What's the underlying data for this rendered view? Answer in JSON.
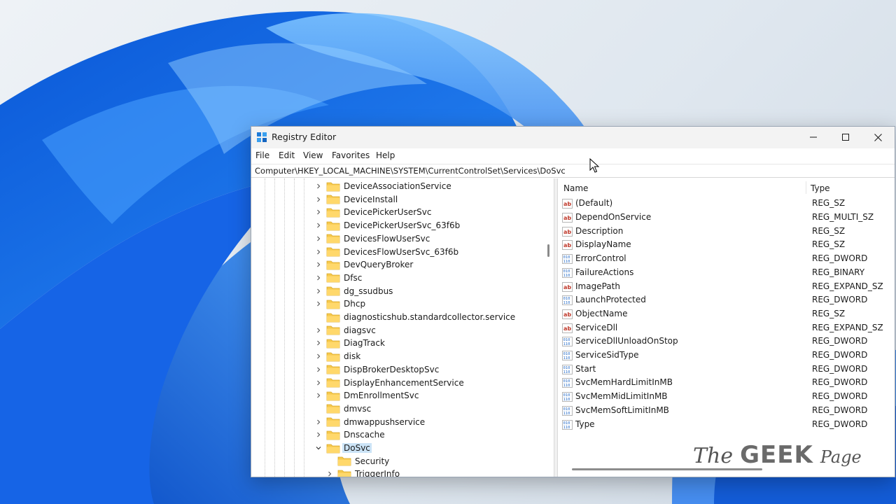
{
  "window": {
    "title": "Registry Editor",
    "icon": "registry-editor-icon"
  },
  "menu": [
    "File",
    "Edit",
    "View",
    "Favorites",
    "Help"
  ],
  "address": "Computer\\HKEY_LOCAL_MACHINE\\SYSTEM\\CurrentControlSet\\Services\\DoSvc",
  "tree": {
    "items": [
      {
        "label": "DeviceAssociationService",
        "expander": "collapsed"
      },
      {
        "label": "DeviceInstall",
        "expander": "collapsed"
      },
      {
        "label": "DevicePickerUserSvc",
        "expander": "collapsed"
      },
      {
        "label": "DevicePickerUserSvc_63f6b",
        "expander": "collapsed"
      },
      {
        "label": "DevicesFlowUserSvc",
        "expander": "collapsed"
      },
      {
        "label": "DevicesFlowUserSvc_63f6b",
        "expander": "collapsed"
      },
      {
        "label": "DevQueryBroker",
        "expander": "collapsed"
      },
      {
        "label": "Dfsc",
        "expander": "collapsed"
      },
      {
        "label": "dg_ssudbus",
        "expander": "collapsed"
      },
      {
        "label": "Dhcp",
        "expander": "collapsed"
      },
      {
        "label": "diagnosticshub.standardcollector.service",
        "expander": "none"
      },
      {
        "label": "diagsvc",
        "expander": "collapsed"
      },
      {
        "label": "DiagTrack",
        "expander": "collapsed"
      },
      {
        "label": "disk",
        "expander": "collapsed"
      },
      {
        "label": "DispBrokerDesktopSvc",
        "expander": "collapsed"
      },
      {
        "label": "DisplayEnhancementService",
        "expander": "collapsed"
      },
      {
        "label": "DmEnrollmentSvc",
        "expander": "collapsed"
      },
      {
        "label": "dmvsc",
        "expander": "none"
      },
      {
        "label": "dmwappushservice",
        "expander": "collapsed"
      },
      {
        "label": "Dnscache",
        "expander": "collapsed"
      },
      {
        "label": "DoSvc",
        "expander": "expanded",
        "selected": true
      },
      {
        "label": "Security",
        "expander": "none",
        "child": true
      },
      {
        "label": "TriggerInfo",
        "expander": "collapsed",
        "child": true
      }
    ]
  },
  "values": {
    "columns": {
      "name": "Name",
      "type": "Type"
    },
    "rows": [
      {
        "name": "(Default)",
        "type": "REG_SZ",
        "icon": "string-value-icon"
      },
      {
        "name": "DependOnService",
        "type": "REG_MULTI_SZ",
        "icon": "string-value-icon"
      },
      {
        "name": "Description",
        "type": "REG_SZ",
        "icon": "string-value-icon"
      },
      {
        "name": "DisplayName",
        "type": "REG_SZ",
        "icon": "string-value-icon"
      },
      {
        "name": "ErrorControl",
        "type": "REG_DWORD",
        "icon": "binary-value-icon"
      },
      {
        "name": "FailureActions",
        "type": "REG_BINARY",
        "icon": "binary-value-icon"
      },
      {
        "name": "ImagePath",
        "type": "REG_EXPAND_SZ",
        "icon": "string-value-icon"
      },
      {
        "name": "LaunchProtected",
        "type": "REG_DWORD",
        "icon": "binary-value-icon"
      },
      {
        "name": "ObjectName",
        "type": "REG_SZ",
        "icon": "string-value-icon"
      },
      {
        "name": "ServiceDll",
        "type": "REG_EXPAND_SZ",
        "icon": "string-value-icon"
      },
      {
        "name": "ServiceDllUnloadOnStop",
        "type": "REG_DWORD",
        "icon": "binary-value-icon"
      },
      {
        "name": "ServiceSidType",
        "type": "REG_DWORD",
        "icon": "binary-value-icon"
      },
      {
        "name": "Start",
        "type": "REG_DWORD",
        "icon": "binary-value-icon"
      },
      {
        "name": "SvcMemHardLimitInMB",
        "type": "REG_DWORD",
        "icon": "binary-value-icon"
      },
      {
        "name": "SvcMemMidLimitInMB",
        "type": "REG_DWORD",
        "icon": "binary-value-icon"
      },
      {
        "name": "SvcMemSoftLimitInMB",
        "type": "REG_DWORD",
        "icon": "binary-value-icon"
      },
      {
        "name": "Type",
        "type": "REG_DWORD",
        "icon": "binary-value-icon"
      }
    ]
  },
  "watermark": {
    "the": "The",
    "geek": "GEEK",
    "page": "Page"
  },
  "colors": {
    "wallpaper_blue": "#1f6fe0",
    "selection": "#cce4f7",
    "folder": "#f6c94c",
    "string_icon": "#c0392b",
    "binary_icon": "#2a6fc9"
  }
}
